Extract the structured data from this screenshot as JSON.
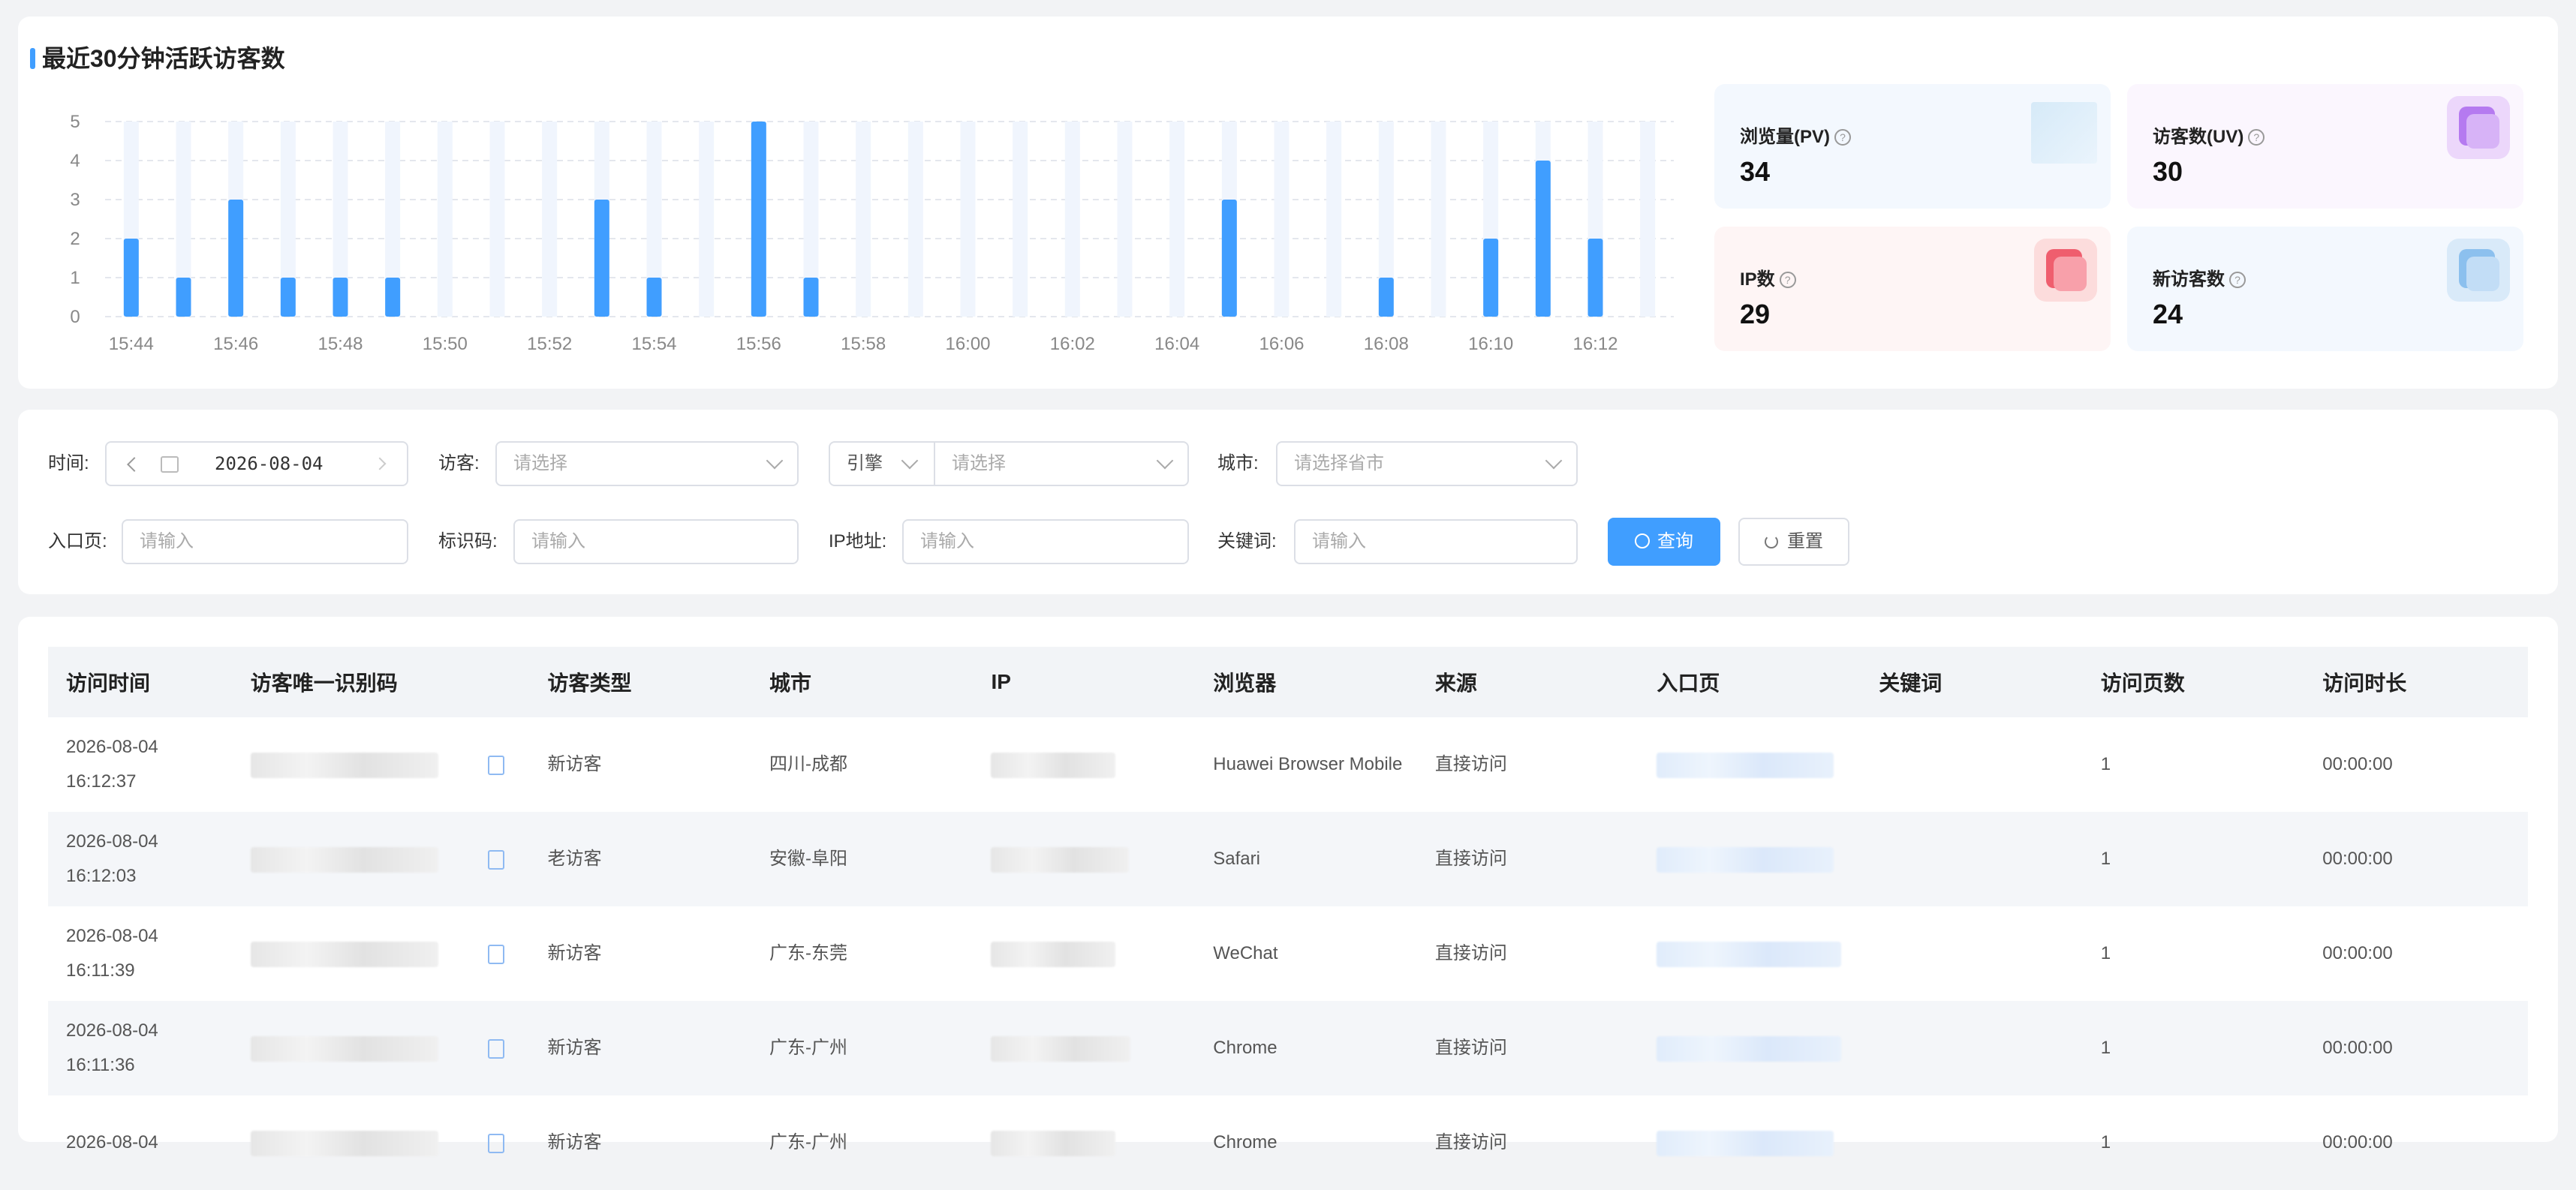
{
  "title": "最近30分钟活跃访客数",
  "chart_data": {
    "type": "bar",
    "categories": [
      "15:44",
      "15:45",
      "15:46",
      "15:47",
      "15:48",
      "15:49",
      "15:50",
      "15:51",
      "15:52",
      "15:53",
      "15:54",
      "15:55",
      "15:56",
      "15:57",
      "15:58",
      "15:59",
      "16:00",
      "16:01",
      "16:02",
      "16:03",
      "16:04",
      "16:05",
      "16:06",
      "16:07",
      "16:08",
      "16:09",
      "16:10",
      "16:11",
      "16:12",
      "16:13"
    ],
    "tick_labels": [
      "15:44",
      "15:46",
      "15:48",
      "15:50",
      "15:52",
      "15:54",
      "15:56",
      "15:58",
      "16:00",
      "16:02",
      "16:04",
      "16:06",
      "16:08",
      "16:10",
      "16:12"
    ],
    "values": [
      2,
      1,
      3,
      1,
      1,
      1,
      0,
      0,
      0,
      3,
      1,
      0,
      5,
      1,
      0,
      0,
      0,
      0,
      0,
      0,
      0,
      3,
      0,
      0,
      1,
      0,
      2,
      4,
      2,
      0
    ],
    "ylim": [
      0,
      5
    ],
    "yticks": [
      0,
      1,
      2,
      3,
      4,
      5
    ],
    "bar_color": "#409eff",
    "track_color": "#f0f5fd",
    "grid": true
  },
  "stats": {
    "pv": {
      "label": "浏览量(PV)",
      "value": "34"
    },
    "uv": {
      "label": "访客数(UV)",
      "value": "30"
    },
    "ip": {
      "label": "IP数",
      "value": "29"
    },
    "new": {
      "label": "新访客数",
      "value": "24"
    }
  },
  "filters": {
    "time_label": "时间:",
    "date": "2026-08-04",
    "visitor_label": "访客:",
    "visitor_placeholder": "请选择",
    "engine_select": "引擎",
    "engine_placeholder": "请选择",
    "city_label": "城市:",
    "city_placeholder": "请选择省市",
    "entry_label": "入口页:",
    "entry_placeholder": "请输入",
    "code_label": "标识码:",
    "code_placeholder": "请输入",
    "ip_label": "IP地址:",
    "ip_placeholder": "请输入",
    "keyword_label": "关键词:",
    "keyword_placeholder": "请输入",
    "query_button": "查询",
    "reset_button": "重置"
  },
  "table": {
    "headers": [
      "访问时间",
      "访客唯一识别码",
      "访客类型",
      "城市",
      "IP",
      "浏览器",
      "来源",
      "入口页",
      "关键词",
      "访问页数",
      "访问时长"
    ],
    "rows": [
      {
        "date": "2026-08-04",
        "time": "16:12:37",
        "type": "新访客",
        "city": "四川-成都",
        "browser": "Huawei Browser Mobile",
        "source": "直接访问",
        "pages": "1",
        "duration": "00:00:00"
      },
      {
        "date": "2026-08-04",
        "time": "16:12:03",
        "type": "老访客",
        "city": "安徽-阜阳",
        "browser": "Safari",
        "source": "直接访问",
        "pages": "1",
        "duration": "00:00:00"
      },
      {
        "date": "2026-08-04",
        "time": "16:11:39",
        "type": "新访客",
        "city": "广东-东莞",
        "browser": "WeChat",
        "source": "直接访问",
        "pages": "1",
        "duration": "00:00:00"
      },
      {
        "date": "2026-08-04",
        "time": "16:11:36",
        "type": "新访客",
        "city": "广东-广州",
        "browser": "Chrome",
        "source": "直接访问",
        "pages": "1",
        "duration": "00:00:00"
      },
      {
        "date": "2026-08-04",
        "time": "",
        "type": "新访客",
        "city": "广东-广州",
        "browser": "Chrome",
        "source": "直接访问",
        "pages": "1",
        "duration": "00:00:00"
      }
    ]
  }
}
